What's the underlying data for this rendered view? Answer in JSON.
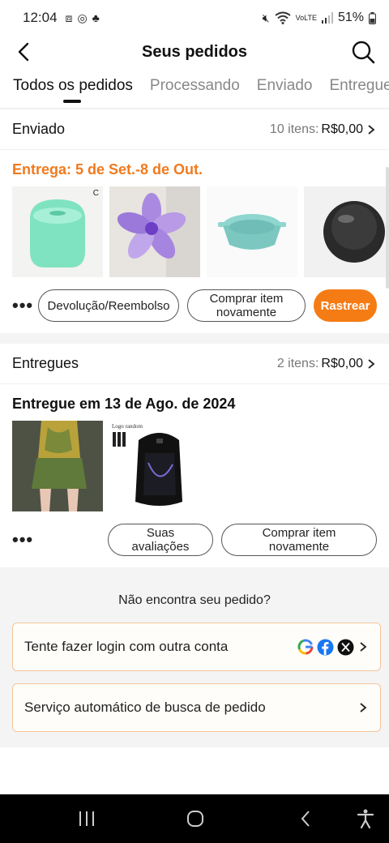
{
  "status_bar": {
    "time": "12:04",
    "battery": "51%"
  },
  "header": {
    "title": "Seus pedidos"
  },
  "tabs": [
    {
      "label": "Todos os pedidos",
      "active": true
    },
    {
      "label": "Processando"
    },
    {
      "label": "Enviado"
    },
    {
      "label": "Entregue"
    }
  ],
  "orders": [
    {
      "status": "Enviado",
      "items_label": "10 itens:",
      "price": "R$0,00",
      "delivery_text": "Entrega: 5 de Set.-8 de Out.",
      "product_icons": [
        "humidifier",
        "hair-claw",
        "silicone-liner",
        "speaker"
      ],
      "buttons": [
        "Devolução/Reembolso",
        "Comprar item novamente",
        "Rastrear"
      ]
    },
    {
      "status": "Entregues",
      "items_label": "2 itens:",
      "price": "R$0,00",
      "delivery_text": "Entregue em 13 de Ago. de 2024",
      "product_icons": [
        "skirt-outfit",
        "backpack"
      ],
      "buttons": [
        "Suas avaliações",
        "Comprar item novamente"
      ]
    }
  ],
  "thumb_text": {
    "corner_mark": "C",
    "backpack_caption": "Logo random"
  },
  "help": {
    "question": "Não encontra seu pedido?",
    "login_option": "Tente fazer login com outra conta",
    "auto_search": "Serviço automático de busca de pedido"
  },
  "colors": {
    "accent": "#f57c15",
    "delivery_orange": "#f07a1e"
  }
}
